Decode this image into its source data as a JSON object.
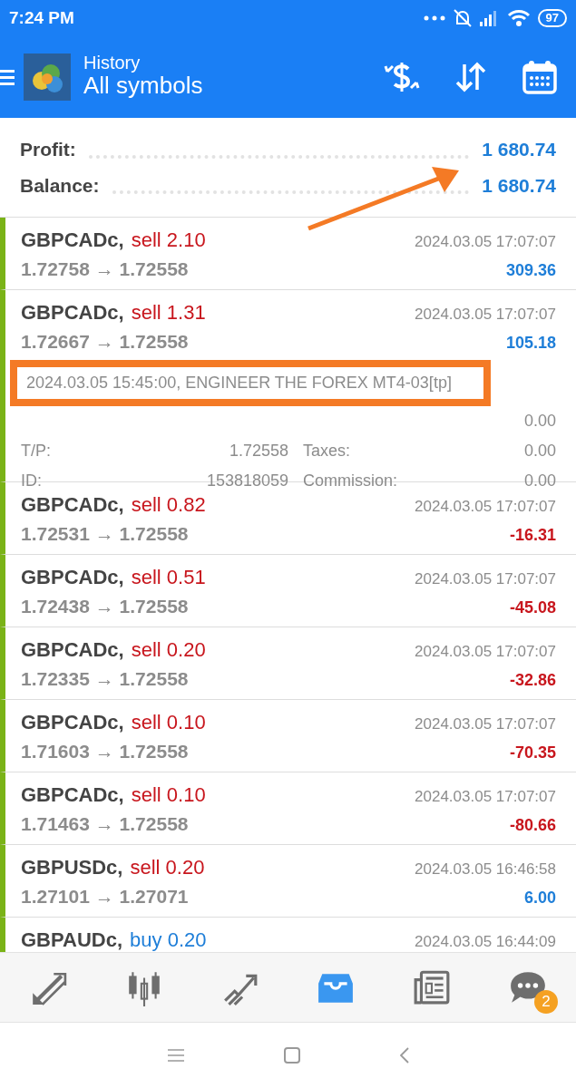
{
  "status_bar": {
    "time": "7:24 PM",
    "battery": "97"
  },
  "header": {
    "title": "History",
    "subtitle": "All symbols"
  },
  "summary": [
    {
      "label": "Profit:",
      "value": "1 680.74"
    },
    {
      "label": "Balance:",
      "value": "1 680.74"
    }
  ],
  "deals": [
    {
      "symbol": "GBPCADc,",
      "side": "sell",
      "volume": "2.10",
      "open": "1.72758",
      "close": "1.72558",
      "arrow": "→",
      "time": "2024.03.05 17:07:07",
      "profit": "309.36",
      "expanded": false
    },
    {
      "symbol": "GBPCADc,",
      "side": "sell",
      "volume": "1.31",
      "open": "1.72667",
      "close": "1.72558",
      "arrow": "→",
      "time": "2024.03.05 17:07:07",
      "profit": "105.18",
      "expanded": true,
      "details": {
        "comment": "2024.03.05 15:45:00, ENGINEER THE FOREX MT4-03[tp]",
        "rows": [
          {
            "right": {
              "value": "0.00"
            }
          },
          {
            "left": {
              "label": "T/P:",
              "value": "1.72558"
            },
            "right": {
              "label": "Taxes:",
              "value": "0.00"
            }
          },
          {
            "left": {
              "label": "ID:",
              "value": "153818059"
            },
            "right": {
              "label": "Commission:",
              "value": "0.00"
            }
          }
        ]
      }
    },
    {
      "symbol": "GBPCADc,",
      "side": "sell",
      "volume": "0.82",
      "open": "1.72531",
      "close": "1.72558",
      "arrow": "→",
      "time": "2024.03.05 17:07:07",
      "profit": "-16.31",
      "expanded": false
    },
    {
      "symbol": "GBPCADc,",
      "side": "sell",
      "volume": "0.51",
      "open": "1.72438",
      "close": "1.72558",
      "arrow": "→",
      "time": "2024.03.05 17:07:07",
      "profit": "-45.08",
      "expanded": false
    },
    {
      "symbol": "GBPCADc,",
      "side": "sell",
      "volume": "0.20",
      "open": "1.72335",
      "close": "1.72558",
      "arrow": "→",
      "time": "2024.03.05 17:07:07",
      "profit": "-32.86",
      "expanded": false
    },
    {
      "symbol": "GBPCADc,",
      "side": "sell",
      "volume": "0.10",
      "open": "1.71603",
      "close": "1.72558",
      "arrow": "→",
      "time": "2024.03.05 17:07:07",
      "profit": "-70.35",
      "expanded": false
    },
    {
      "symbol": "GBPCADc,",
      "side": "sell",
      "volume": "0.10",
      "open": "1.71463",
      "close": "1.72558",
      "arrow": "→",
      "time": "2024.03.05 17:07:07",
      "profit": "-80.66",
      "expanded": false
    },
    {
      "symbol": "GBPUSDc,",
      "side": "sell",
      "volume": "0.20",
      "open": "1.27101",
      "close": "1.27071",
      "arrow": "→",
      "time": "2024.03.05 16:46:58",
      "profit": "6.00",
      "expanded": false
    },
    {
      "symbol": "GBPAUDc,",
      "side": "buy",
      "volume": "0.20",
      "time": "2024.03.05 16:44:09",
      "expanded": false
    }
  ],
  "tabs": [
    {
      "kind": "trade",
      "selected": false
    },
    {
      "kind": "quotes",
      "selected": false
    },
    {
      "kind": "chart",
      "selected": false
    },
    {
      "kind": "history",
      "selected": true
    },
    {
      "kind": "news",
      "selected": false
    },
    {
      "kind": "chat",
      "selected": false,
      "badge": "2"
    }
  ]
}
